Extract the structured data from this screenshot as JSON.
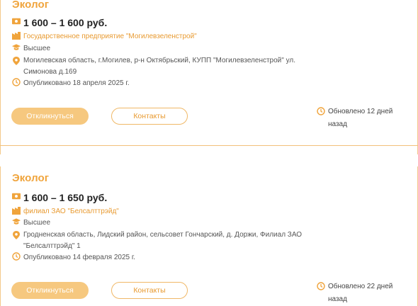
{
  "vacancies": [
    {
      "title": "Эколог",
      "salary": "1 600 – 1 600 руб.",
      "company": "Государственное предприятие \"Могилевзеленстрой\"",
      "education": "Высшее",
      "address_line1": "Могилевская область, г.Могилев, р-н Октябрьский, КУПП \"Могилевзеленстрой\" ул.",
      "address_line2": "Симонова д.169",
      "published": "Опубликовано 18 апреля 2025 г.",
      "apply_label": "Откликнуться",
      "contacts_label": "Контакты",
      "updated_line1": "Обновлено 12 дней",
      "updated_line2": "назад"
    },
    {
      "title": "Эколог",
      "salary": "1 600 – 1 650 руб.",
      "company": "филиал ЗАО \"Белсалттрэйд\"",
      "education": "Высшее",
      "address_line1": "Гродненская область, Лидский район, сельсовет Гончарский, д. Доржи, Филиал ЗАО",
      "address_line2": "\"Белсалттрэйд\" 1",
      "published": "Опубликовано 14 февраля 2025 г.",
      "apply_label": "Откликнуться",
      "contacts_label": "Контакты",
      "updated_line1": "Обновлено 22 дней",
      "updated_line2": "назад"
    }
  ],
  "colors": {
    "accent": "#f0a43c",
    "button_fill": "#f6c87f",
    "border": "#f2c07a"
  },
  "icons": [
    "money-icon",
    "building-icon",
    "graduation-cap-icon",
    "location-pin-icon",
    "clock-icon"
  ]
}
